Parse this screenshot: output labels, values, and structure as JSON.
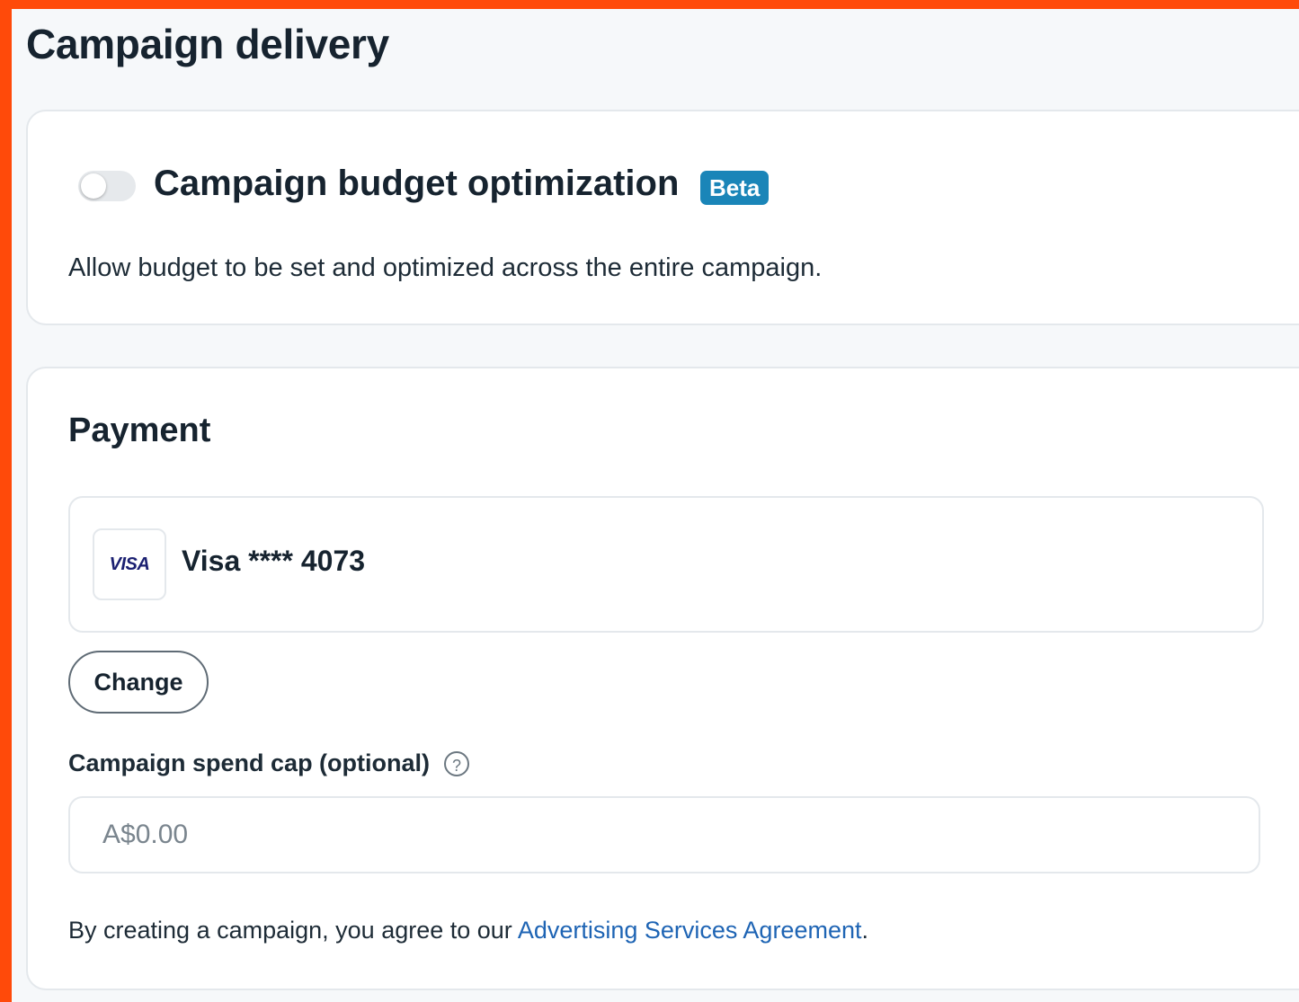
{
  "page": {
    "title": "Campaign delivery"
  },
  "cbo": {
    "title": "Campaign budget optimization",
    "badge": "Beta",
    "description": "Allow budget to be set and optimized across the entire campaign.",
    "toggle_on": false
  },
  "payment": {
    "title": "Payment",
    "card_brand": "VISA",
    "card_label": "Visa **** 4073",
    "change_label": "Change",
    "spend_cap_label": "Campaign spend cap (optional)",
    "help_icon": "question-circle-icon",
    "help_glyph": "?",
    "spend_cap_placeholder": "A$0.00"
  },
  "agreement": {
    "prefix": "By creating a campaign, you agree to our ",
    "link": "Advertising Services Agreement",
    "suffix": "."
  },
  "colors": {
    "frame": "#ff4a0a",
    "badge": "#1a85b8",
    "link": "#1e64b4"
  }
}
